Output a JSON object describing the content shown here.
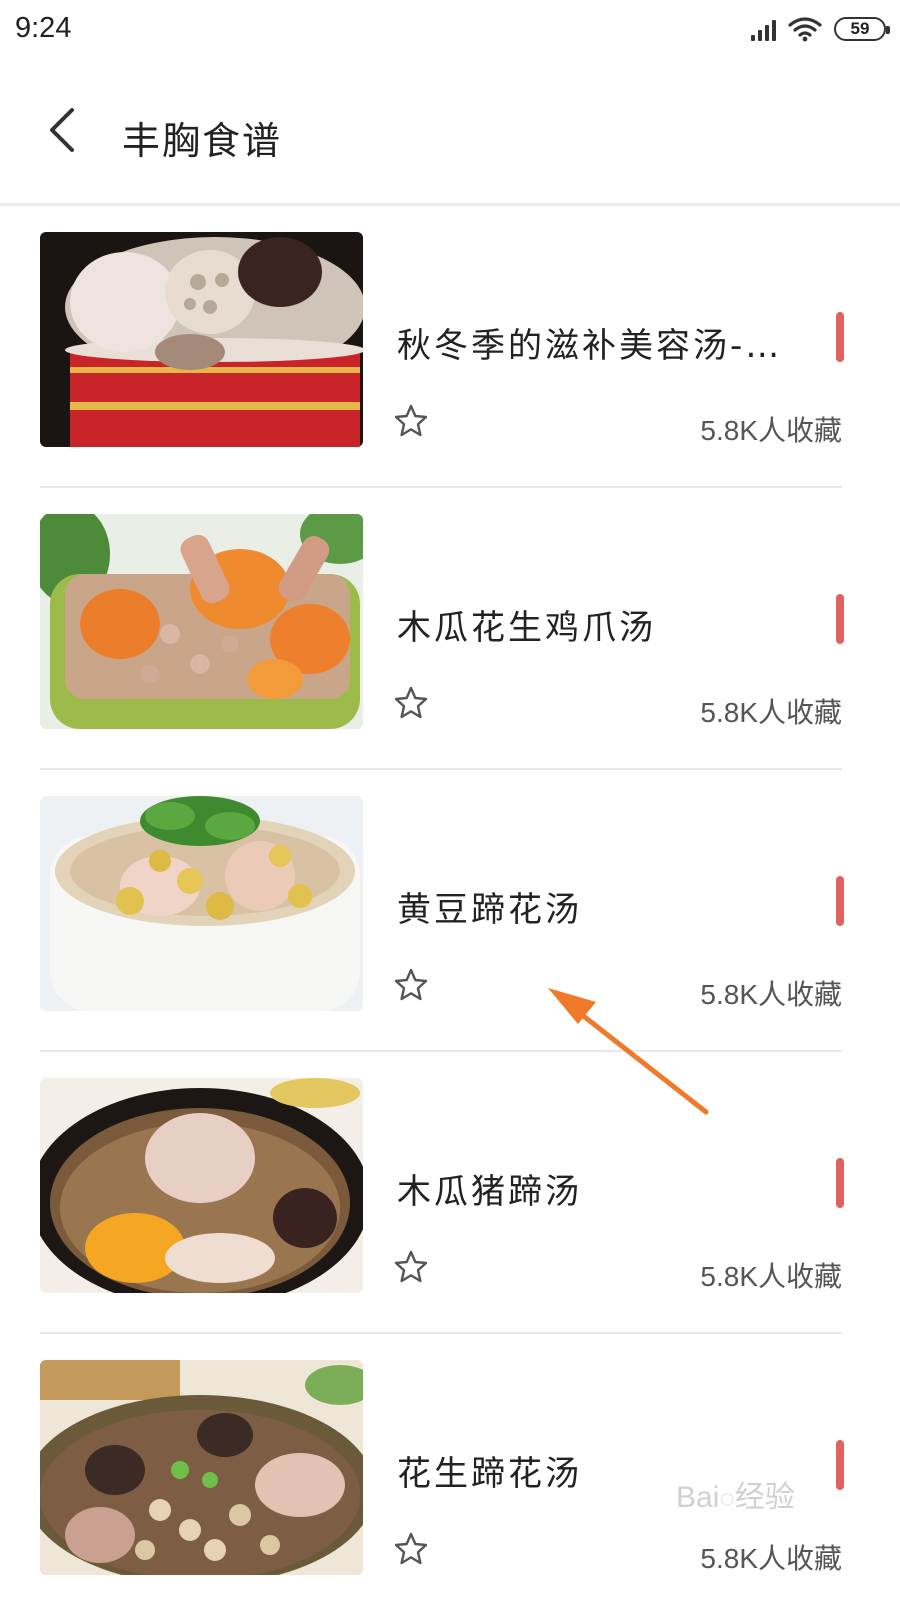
{
  "status_bar": {
    "time": "9:24",
    "battery": "59",
    "icons": [
      "signal-icon",
      "wifi-icon",
      "battery-icon"
    ]
  },
  "header": {
    "title": "丰胸食谱",
    "back_icon": "back-arrow-icon"
  },
  "accent_color": "#e0615f",
  "recipes": [
    {
      "title": "秋冬季的滋补美容汤-…",
      "favorites": "5.8K人收藏",
      "image": "lotus-root-pork-soup-photo"
    },
    {
      "title": "木瓜花生鸡爪汤",
      "favorites": "5.8K人收藏",
      "image": "papaya-peanut-chicken-feet-soup-photo"
    },
    {
      "title": "黄豆蹄花汤",
      "favorites": "5.8K人收藏",
      "image": "soybean-trotter-soup-photo"
    },
    {
      "title": "木瓜猪蹄汤",
      "favorites": "5.8K人收藏",
      "image": "papaya-pig-trotter-soup-photo"
    },
    {
      "title": "花生蹄花汤",
      "favorites": "5.8K人收藏",
      "image": "peanut-trotter-soup-photo"
    }
  ],
  "annotation": {
    "arrow_color": "#f07a2a"
  },
  "watermark": "Bai经验"
}
